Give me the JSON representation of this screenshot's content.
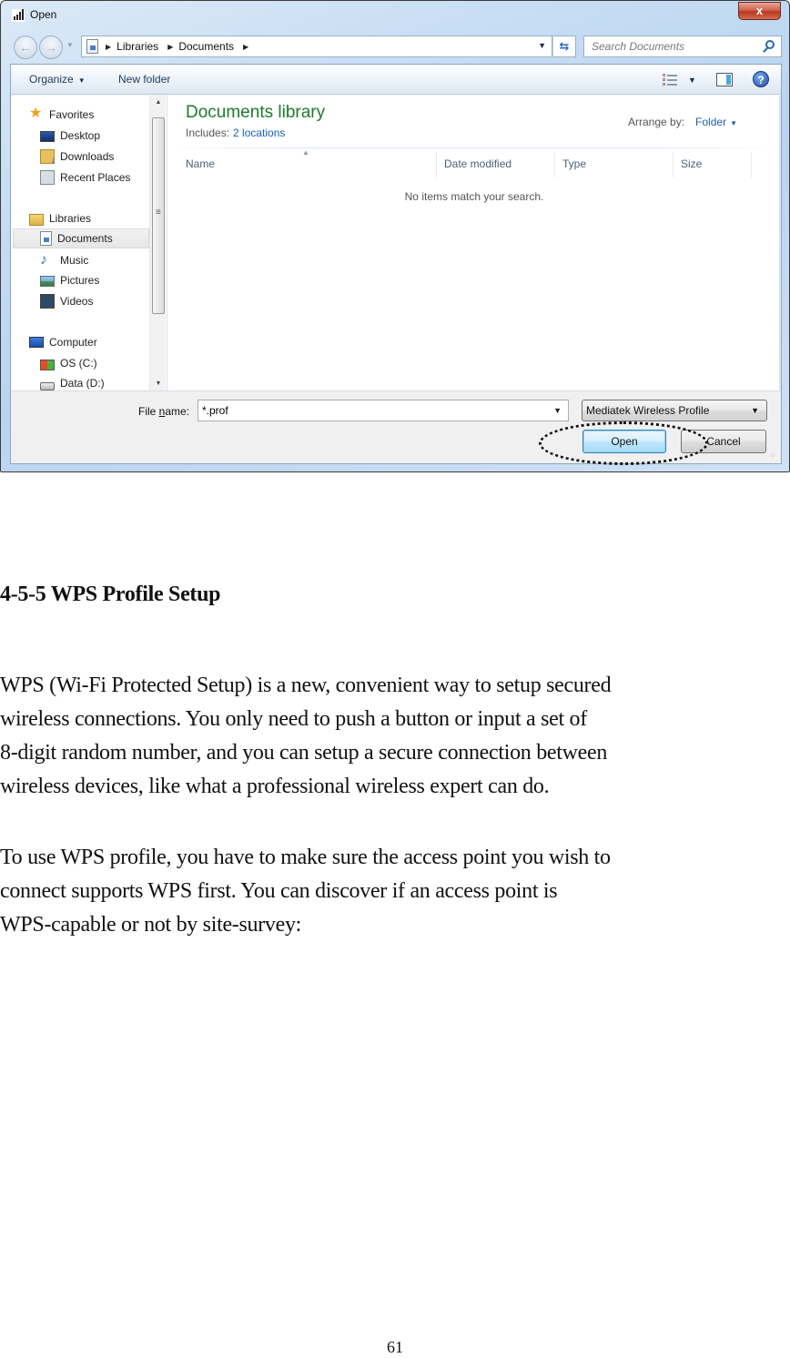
{
  "dialog": {
    "title": "Open",
    "close_label": "x",
    "address": {
      "crumbs": [
        "Libraries",
        "Documents"
      ]
    },
    "search_placeholder": "Search Documents",
    "toolbar": {
      "organize_label": "Organize",
      "new_folder_label": "New folder"
    },
    "nav_pane": {
      "items": [
        {
          "label": "Favorites",
          "icon": "star-icon"
        },
        {
          "label": "Desktop",
          "icon": "desktop-icon"
        },
        {
          "label": "Downloads",
          "icon": "downloads-icon"
        },
        {
          "label": "Recent Places",
          "icon": "recent-places-icon"
        },
        {
          "label": "Libraries",
          "icon": "libraries-icon"
        },
        {
          "label": "Documents",
          "icon": "documents-icon",
          "selected": true
        },
        {
          "label": "Music",
          "icon": "music-icon"
        },
        {
          "label": "Pictures",
          "icon": "pictures-icon"
        },
        {
          "label": "Videos",
          "icon": "videos-icon"
        },
        {
          "label": "Computer",
          "icon": "computer-icon"
        },
        {
          "label": "OS (C:)",
          "icon": "drive-c-icon"
        },
        {
          "label": "Data (D:)",
          "icon": "drive-d-icon"
        }
      ]
    },
    "library": {
      "title": "Documents library",
      "includes_label": "Includes:",
      "includes_link": "2 locations",
      "arrange_label": "Arrange by:",
      "arrange_value": "Folder"
    },
    "columns": [
      "Name",
      "Date modified",
      "Type",
      "Size"
    ],
    "empty_message": "No items match your search.",
    "file_name_label_pre": "File ",
    "file_name_label_u": "n",
    "file_name_label_post": "ame:",
    "file_name_value": "*.prof",
    "file_type_value": "Mediatek Wireless Profile",
    "open_label": "Open",
    "cancel_label": "Cancel"
  },
  "document": {
    "heading": "4-5-5 WPS Profile Setup",
    "paragraph1": [
      "WPS (Wi-Fi Protected Setup) is a new, convenient way to setup secured",
      "wireless connections. You only need to push a button or input a set of",
      "8-digit random number, and you can setup a secure connection between",
      "wireless devices, like what a professional wireless expert can do."
    ],
    "paragraph2": [
      "To use WPS profile, you have to make sure the access point you wish to",
      "connect supports WPS first. You can discover if an access point is",
      "WPS-capable or not by site-survey:"
    ],
    "page_number": "61"
  }
}
